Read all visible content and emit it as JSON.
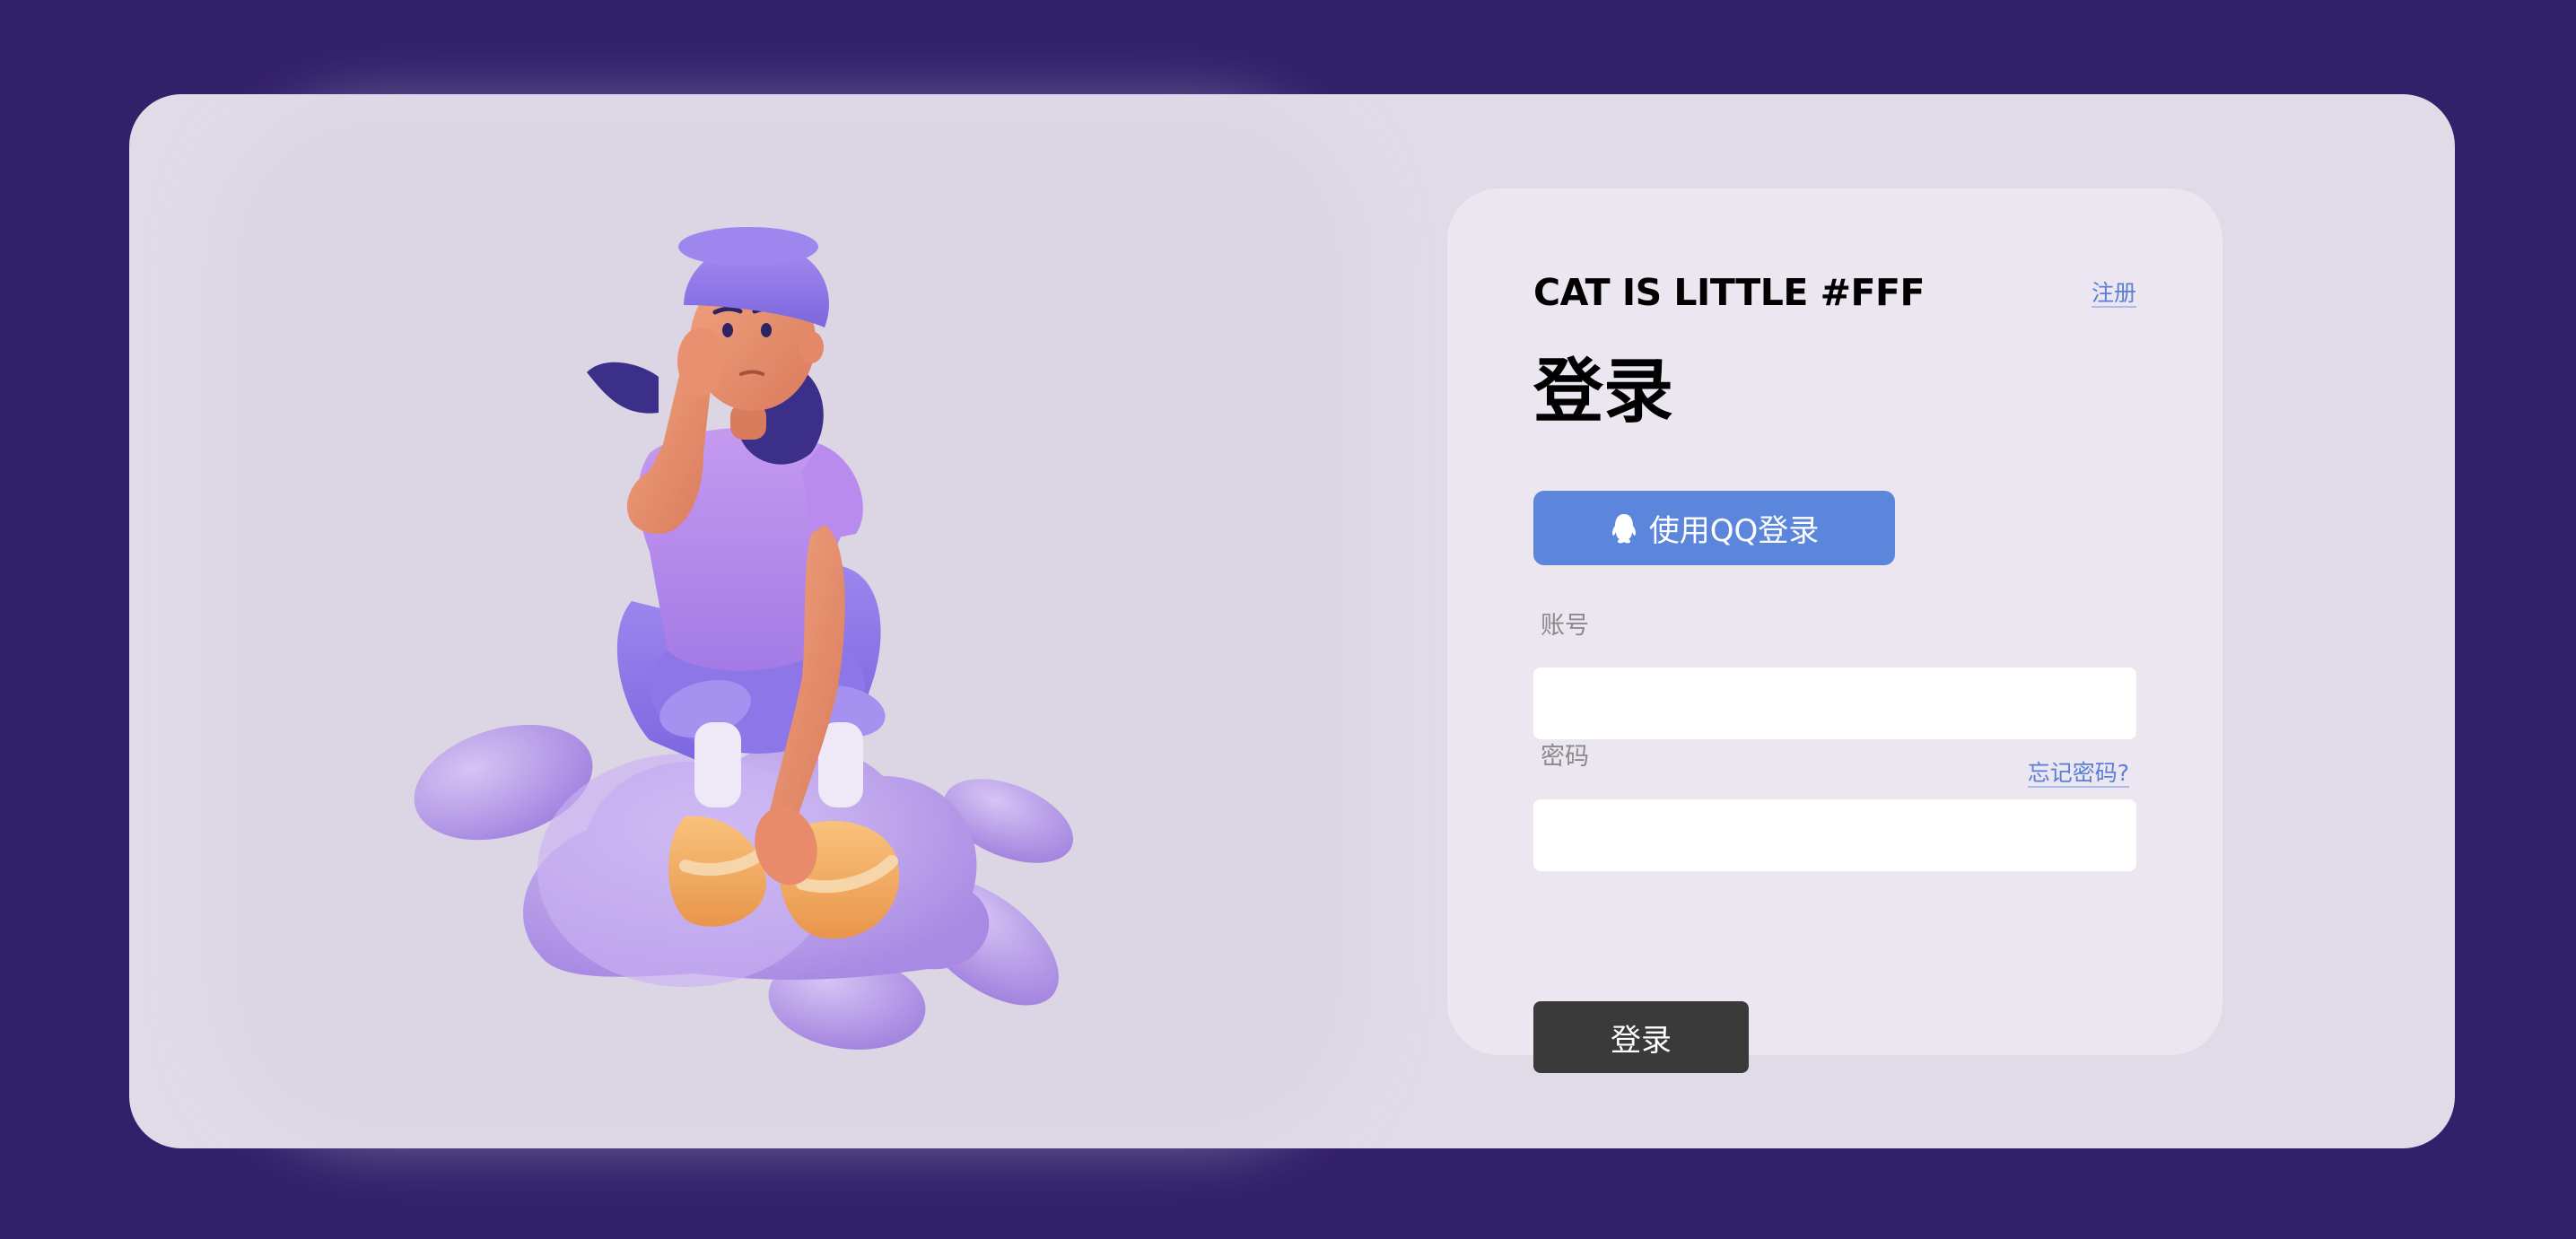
{
  "colors": {
    "page_background": "#31206a",
    "card_background": "#e1dbe7",
    "panel_background": "#ebe6ef",
    "qq_button": "#5b86dc",
    "submit_button": "#3a3a3a",
    "link": "#5b7fd6"
  },
  "illustration": {
    "icon": "girl-sitting-on-cloud-illustration"
  },
  "login": {
    "brand": "CAT IS LITTLE #FFF",
    "register_link": "注册",
    "title": "登录",
    "qq_button_label": "使用QQ登录",
    "qq_icon": "qq-penguin-icon",
    "account_label": "账号",
    "account_value": "",
    "password_label": "密码",
    "password_value": "",
    "forgot_link": "忘记密码?",
    "submit_label": "登录"
  }
}
